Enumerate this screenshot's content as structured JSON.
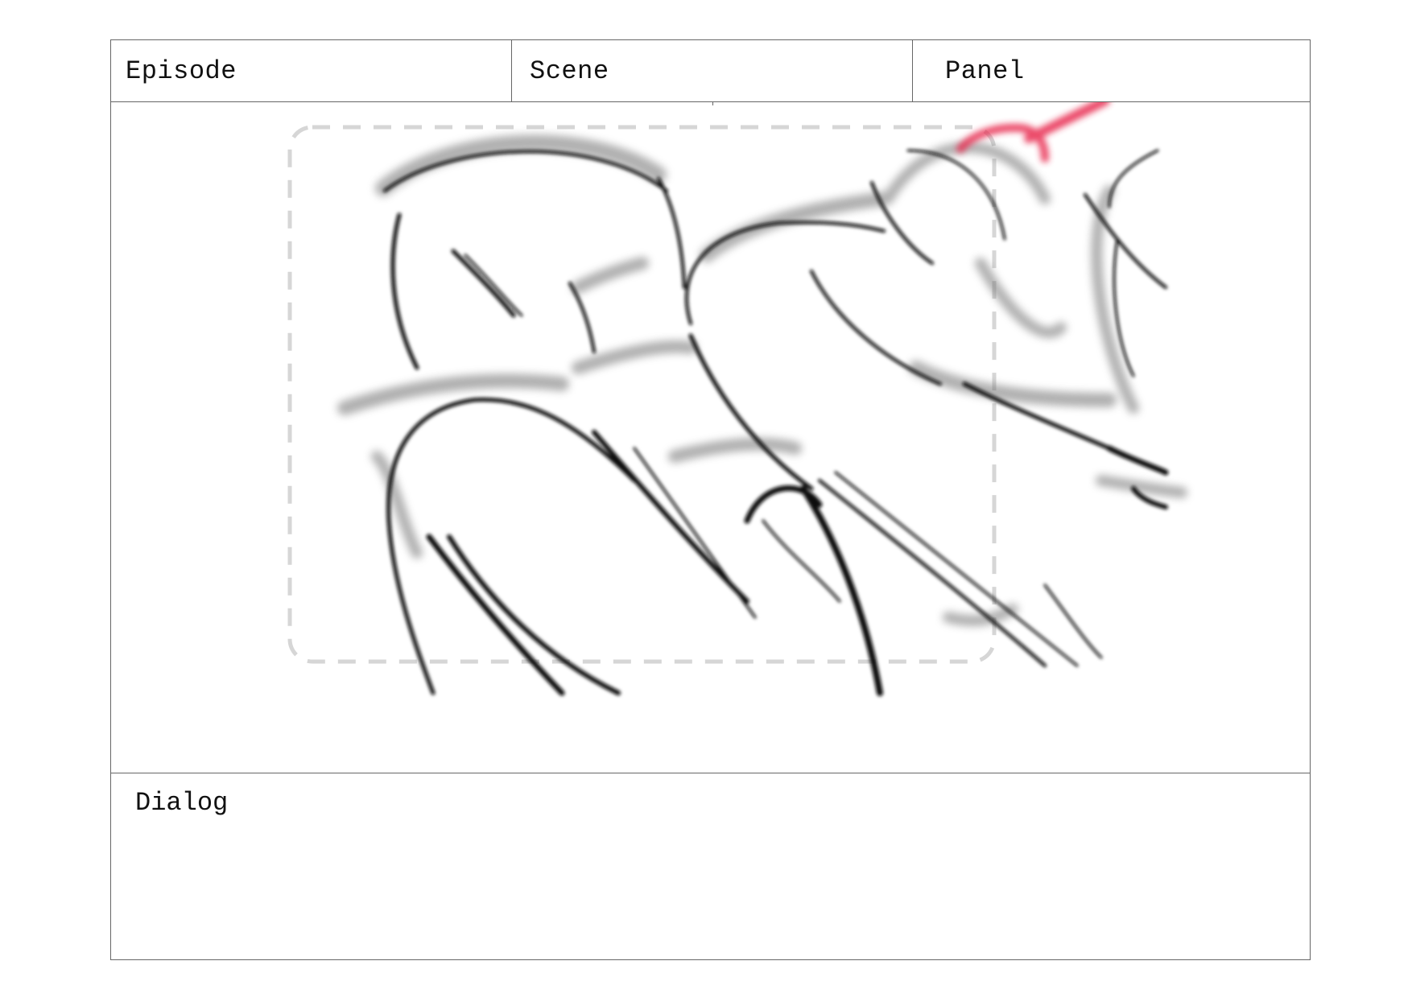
{
  "storyboard": {
    "header": {
      "episode_label": "Episode",
      "scene_label": "Scene",
      "panel_label": "Panel"
    },
    "dialog_label": "Dialog"
  },
  "colors": {
    "border": "#666666",
    "sketch_line": "#111111",
    "accent_stroke": "#e8294f",
    "safe_frame": "#d6d6d6"
  }
}
